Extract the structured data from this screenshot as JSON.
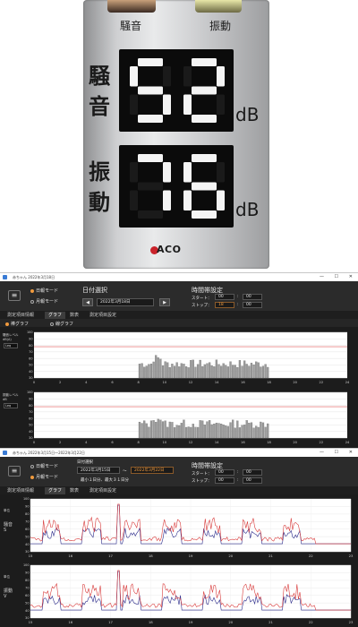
{
  "panel": {
    "header_noise": "騒音",
    "header_vibration": "振動",
    "row1_char1": "騒",
    "row1_char2": "音",
    "row2_char1": "振",
    "row2_char2": "動",
    "noise_value": "52",
    "vibration_value": "76",
    "unit1": "dB",
    "unit2": "dB",
    "logo": "ACO"
  },
  "window1": {
    "title": "赤ちゃん  2022年3月18日",
    "radio_daily": "日報モード",
    "radio_monthly": "月報モード",
    "date_select_label": "日付選択",
    "date_value": "2022年3月18日",
    "prev": "◀",
    "next": "▶",
    "time_band_label": "時間帯設定",
    "start_label": "スタート：",
    "stop_label": "ストップ：",
    "start_h": "00",
    "start_m": "00",
    "stop_h": "18",
    "stop_m": "00",
    "colon": ":",
    "tabs": [
      "測定項目情報",
      "グラフ",
      "数表",
      "測定項目設定"
    ],
    "graph_bar_label": "棒グラフ",
    "graph_line_label": "線グラフ",
    "chart1_ylabel": "騒音レベル dB(A)",
    "chart2_ylabel": "振動レベル dB",
    "select_val": "Leq",
    "yticks1": [
      "100",
      "90",
      "80",
      "70",
      "60",
      "50",
      "40",
      "30"
    ],
    "yticks2": [
      "100",
      "90",
      "80",
      "70",
      "60",
      "50",
      "40",
      "30"
    ],
    "xticks": [
      "0",
      "2",
      "4",
      "6",
      "8",
      "10",
      "12",
      "14",
      "16",
      "18",
      "20",
      "22",
      "24"
    ],
    "window_close": "✕",
    "window_min": "—",
    "window_max": "☐"
  },
  "window2": {
    "title": "赤ちゃん  2022年3月15日〜2022年3月22日",
    "radio_daily": "日報モード",
    "radio_monthly": "月報モード",
    "date_select_label": "日付選択",
    "date_from": "2022年3月15日",
    "date_to": "2022年3月22日",
    "tilde": "〜",
    "note": "最小１日分、最大３１日分",
    "time_band_label": "時間帯設定",
    "start_label": "スタート：",
    "stop_label": "ストップ：",
    "start_h": "00",
    "start_m": "00",
    "stop_h": "00",
    "stop_m": "00",
    "colon": ":",
    "tabs": [
      "測定項目情報",
      "グラフ",
      "数表",
      "測定項目設定"
    ],
    "chart1_label1": "騒音",
    "chart1_label2": "S",
    "chart2_label1": "振動",
    "chart2_label2": "V",
    "unit": "単位",
    "yticks": [
      "100",
      "90",
      "80",
      "70",
      "60",
      "50",
      "40",
      "30"
    ],
    "xticks": [
      "15",
      "16",
      "17",
      "18",
      "19",
      "20",
      "21",
      "22",
      "23"
    ],
    "window_close": "✕",
    "window_min": "—",
    "window_max": "☐"
  },
  "colors": {
    "accent_orange": "#f09a3e",
    "limit_line_red": "#e05a5a",
    "series_red": "#d83a3a",
    "series_blue": "#2a2a8a",
    "led_white": "#f4f4f4"
  }
}
